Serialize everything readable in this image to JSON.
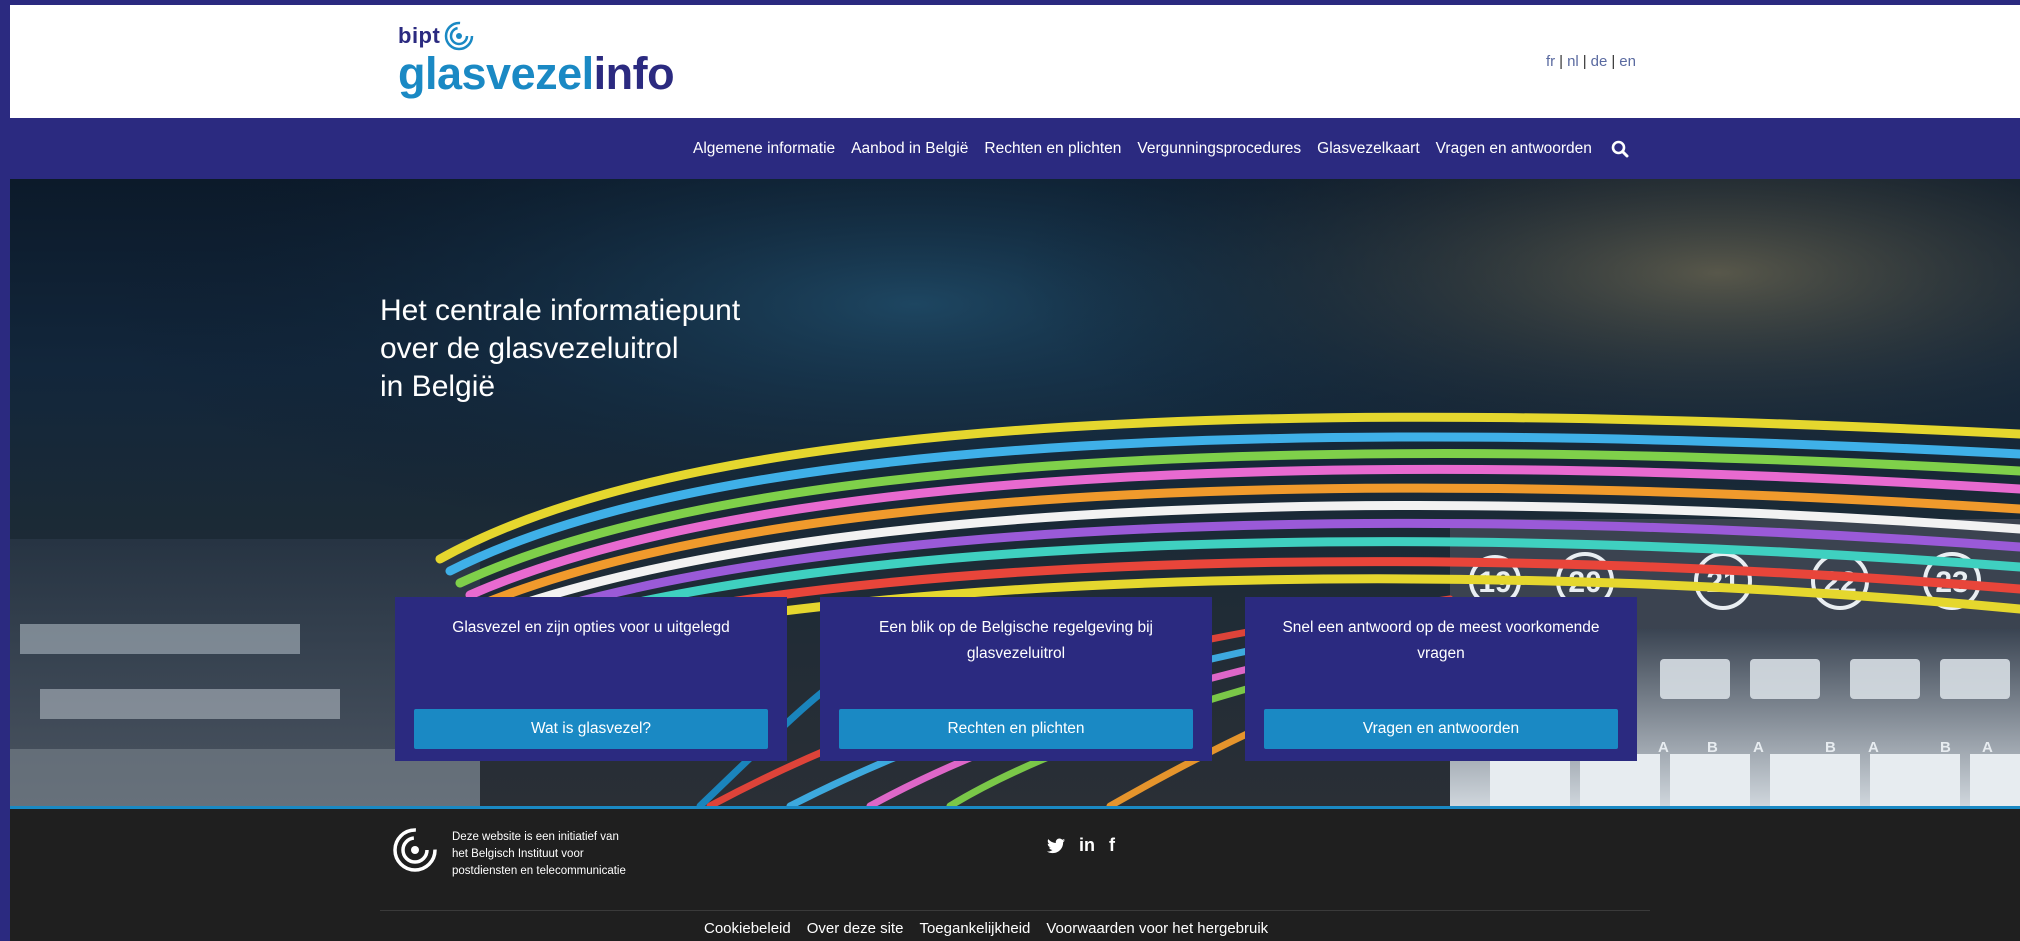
{
  "header": {
    "logo_small": "bipt",
    "logo_glas": "glasvezel",
    "logo_info": "info",
    "languages": [
      "fr",
      "nl",
      "de",
      "en"
    ]
  },
  "nav": {
    "items": [
      "Algemene informatie",
      "Aanbod in België",
      "Rechten en plichten",
      "Vergunningsprocedures",
      "Glasvezelkaart",
      "Vragen en antwoorden"
    ],
    "search_icon": "search-icon"
  },
  "hero": {
    "title_lines": [
      "Het centrale informatiepunt",
      "over de glasvezeluitrol",
      "in België"
    ],
    "panel_numbers": [
      "19",
      "20",
      "21",
      "22",
      "23"
    ],
    "port_letters": [
      "A",
      "B",
      "A",
      "B",
      "A",
      "B",
      "A"
    ]
  },
  "cards": [
    {
      "text": "Glasvezel en zijn opties voor u uitgelegd",
      "button": "Wat is glasvezel?"
    },
    {
      "text": "Een blik op de Belgische regelgeving bij glasvezeluitrol",
      "button": "Rechten en plichten"
    },
    {
      "text": "Snel een antwoord op de meest voorkomende vragen",
      "button": "Vragen en antwoorden"
    }
  ],
  "footer": {
    "initiative_lines": [
      "Deze website is een initiatief van",
      "het Belgisch Instituut voor",
      "postdiensten en telecommunicatie"
    ],
    "social": [
      "twitter-icon",
      "linkedin-icon",
      "facebook-icon"
    ],
    "links": [
      "Cookiebeleid",
      "Over deze site",
      "Toegankelijkheid",
      "Voorwaarden voor het hergebruik"
    ]
  },
  "colors": {
    "brand_dark": "#2b2a80",
    "brand_blue": "#1a89c4",
    "footer_bg": "#1f1f1f"
  }
}
